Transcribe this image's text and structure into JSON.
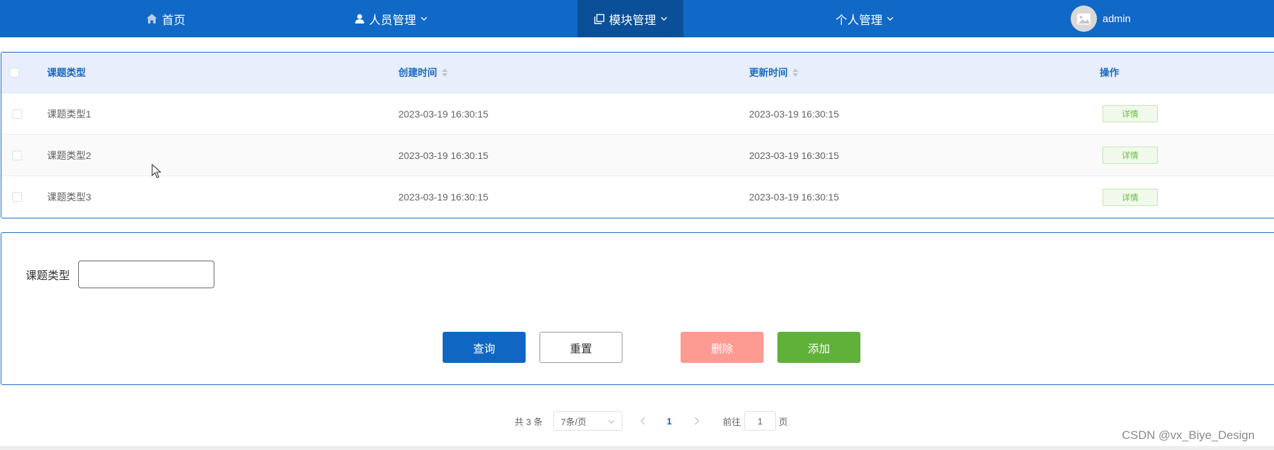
{
  "nav": {
    "home": "首页",
    "personnel": "人员管理",
    "modules": "模块管理",
    "personal": "个人管理",
    "username": "admin"
  },
  "table": {
    "headers": {
      "type": "课题类型",
      "created": "创建时间",
      "updated": "更新时间",
      "actions": "操作"
    },
    "rows": [
      {
        "type": "课题类型1",
        "created": "2023-03-19 16:30:15",
        "updated": "2023-03-19 16:30:15",
        "action": "详情"
      },
      {
        "type": "课题类型2",
        "created": "2023-03-19 16:30:15",
        "updated": "2023-03-19 16:30:15",
        "action": "详情"
      },
      {
        "type": "课题类型3",
        "created": "2023-03-19 16:30:15",
        "updated": "2023-03-19 16:30:15",
        "action": "详情"
      }
    ]
  },
  "search": {
    "label": "课题类型",
    "value": "",
    "query": "查询",
    "reset": "重置",
    "delete": "删除",
    "add": "添加"
  },
  "pagination": {
    "total": "共 3 条",
    "page_size": "7条/页",
    "current_page": "1",
    "goto_prefix": "前往",
    "goto_value": "1",
    "goto_suffix": "页"
  },
  "watermark": "CSDN @vx_Biye_Design",
  "colors": {
    "nav_bg": "#1068c7",
    "nav_active": "#0a4f98",
    "primary": "#0f67c3",
    "danger_light": "#fd9a92",
    "success": "#5fb139"
  }
}
